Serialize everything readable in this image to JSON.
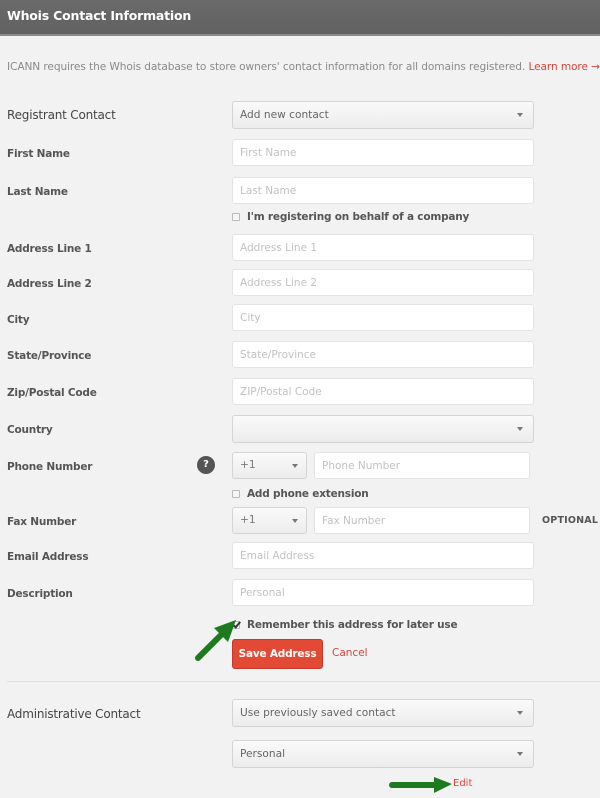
{
  "header": {
    "title": "Whois Contact Information"
  },
  "intro": {
    "text": "ICANN requires the Whois database to store owners' contact information for all domains registered.",
    "link": "Learn more →"
  },
  "registrant": {
    "label": "Registrant Contact",
    "select_value": "Add new contact"
  },
  "fields": {
    "first_name": {
      "label": "First Name",
      "placeholder": "First Name",
      "value": ""
    },
    "last_name": {
      "label": "Last Name",
      "placeholder": "Last Name",
      "value": ""
    },
    "company_checkbox": {
      "label": "I'm registering on behalf of a company",
      "checked": false
    },
    "address1": {
      "label": "Address Line 1",
      "placeholder": "Address Line 1",
      "value": ""
    },
    "address2": {
      "label": "Address Line 2",
      "placeholder": "Address Line 2",
      "value": ""
    },
    "city": {
      "label": "City",
      "placeholder": "City",
      "value": ""
    },
    "state": {
      "label": "State/Province",
      "placeholder": "State/Province",
      "value": ""
    },
    "zip": {
      "label": "Zip/Postal Code",
      "placeholder": "ZIP/Postal Code",
      "value": ""
    },
    "country": {
      "label": "Country",
      "select_value": ""
    },
    "phone": {
      "label": "Phone Number",
      "help_icon": "?",
      "country_code": "+1",
      "placeholder": "Phone Number",
      "value": ""
    },
    "phone_ext_checkbox": {
      "label": "Add phone extension",
      "checked": false
    },
    "fax": {
      "label": "Fax Number",
      "country_code": "+1",
      "placeholder": "Fax Number",
      "value": "",
      "optional_tag": "OPTIONAL"
    },
    "email": {
      "label": "Email Address",
      "placeholder": "Email Address",
      "value": ""
    },
    "description": {
      "label": "Description",
      "placeholder": "Personal",
      "value": ""
    },
    "remember_checkbox": {
      "label": "Remember this address for later use",
      "checked": true
    }
  },
  "actions": {
    "save_label": "Save Address",
    "cancel_label": "Cancel"
  },
  "administrative": {
    "label": "Administrative Contact",
    "select_value": "Use previously saved contact",
    "saved_contact_value": "Personal",
    "edit_label": "Edit"
  },
  "annotations": {
    "arrow_color": "#1e7a1e"
  },
  "colors": {
    "accent": "#e34a35",
    "link": "#d9443a",
    "header_bg": "#666666"
  }
}
